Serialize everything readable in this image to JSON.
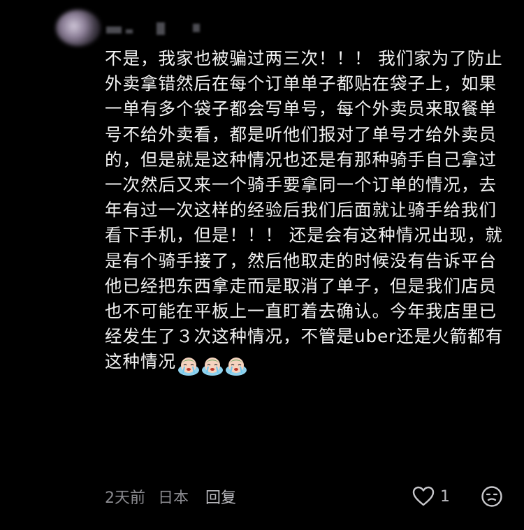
{
  "comment": {
    "author": {
      "name": "",
      "avatar_icon": "avatar-icon"
    },
    "text": "不是，我家也被骗过两三次！！！ 我们家为了防止外卖拿错然后在每个订单单子都贴在袋子上，如果一单有多个袋子都会写单号，每个外卖员来取餐单号不给外卖看，都是听他们报对了单号才给外卖员的，但是就是这种情况也还是有那种骑手自己拿过一次然后又来一个骑手要拿同一个订单的情况，去年有过一次这样的经验后我们后面就让骑手给我们看下手机，但是！！！ 还是会有这种情况出现，就是有个骑手接了，然后他取走的时候没有告诉平台他已经把东西拿走而是取消了单子，但是我们店员也不可能在平板上一直盯着去确认。今年我店里已经发生了３次这种情况，不管是uber还是火箭都有这种情况",
    "emoji": [
      "crying-face-emoji",
      "crying-face-emoji",
      "crying-face-emoji"
    ],
    "time": "2天前",
    "location": "日本",
    "reply_label": "回复",
    "like_count": "1",
    "icons": {
      "like": "heart-icon",
      "dislike": "dislike-face-icon"
    }
  },
  "colors": {
    "background": "#000000",
    "text": "#f2f2f2",
    "meta": "#8a8a8f"
  }
}
